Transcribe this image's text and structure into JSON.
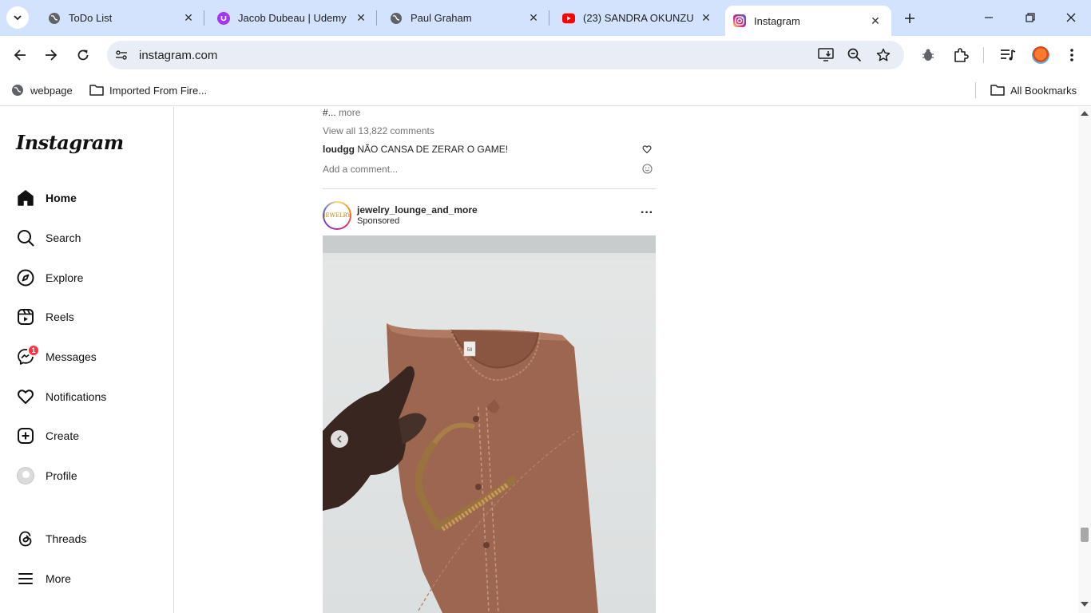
{
  "browser": {
    "tabs": [
      {
        "title": "ToDo List",
        "icon": "globe-icon"
      },
      {
        "title": "Jacob Dubeau | Udemy",
        "icon": "udemy-icon"
      },
      {
        "title": "Paul Graham",
        "icon": "globe-icon"
      },
      {
        "title": "(23) SANDRA OKUNZU",
        "icon": "youtube-icon"
      },
      {
        "title": "Instagram",
        "icon": "instagram-icon",
        "active": true
      }
    ],
    "url": "instagram.com",
    "bookmarks": [
      {
        "label": "webpage",
        "icon": "globe-icon"
      },
      {
        "label": "Imported From Fire...",
        "icon": "folder-icon"
      }
    ],
    "all_bookmarks": "All Bookmarks",
    "colors": {
      "tabbar": "#d3e3fd",
      "omnibox": "#e9eef6"
    }
  },
  "instagram": {
    "logo": "Instagram",
    "nav": [
      {
        "label": "Home",
        "icon": "home-icon",
        "active": true
      },
      {
        "label": "Search",
        "icon": "search-icon"
      },
      {
        "label": "Explore",
        "icon": "compass-icon"
      },
      {
        "label": "Reels",
        "icon": "reels-icon"
      },
      {
        "label": "Messages",
        "icon": "messenger-icon",
        "badge": "1"
      },
      {
        "label": "Notifications",
        "icon": "heart-icon"
      },
      {
        "label": "Create",
        "icon": "plus-square-icon"
      },
      {
        "label": "Profile",
        "icon": "avatar-icon"
      }
    ],
    "nav_bottom": [
      {
        "label": "Threads",
        "icon": "threads-icon"
      },
      {
        "label": "More",
        "icon": "hamburger-icon"
      }
    ],
    "previous_post": {
      "caption_tail": "#...",
      "more": "more",
      "view_all_comments": "View all 13,822 comments",
      "top_comment_user": "loudgg",
      "top_comment_text": "NÃO CANSA DE ZERAR O GAME!",
      "add_comment_placeholder": "Add a comment..."
    },
    "post": {
      "username": "jewelry_lounge_and_more",
      "subtitle": "Sponsored",
      "avatar_text": "JEWELRY",
      "label_tag": "58",
      "badge_color": "#ff3040"
    }
  }
}
